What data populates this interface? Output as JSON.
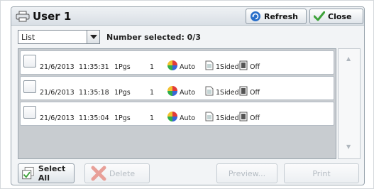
{
  "window": {
    "title": "User 1"
  },
  "header": {
    "refresh_label": "Refresh",
    "close_label": "Close"
  },
  "toolbar": {
    "view_value": "List",
    "selected_text": "Number selected: 0/3"
  },
  "jobs": [
    {
      "date": "21/6/2013",
      "time": "11:35:31",
      "pages": "1Pgs",
      "copies": "1",
      "color": "Auto",
      "sides": "1Sided",
      "staple": "Off"
    },
    {
      "date": "21/6/2013",
      "time": "11:35:18",
      "pages": "1Pgs",
      "copies": "1",
      "color": "Auto",
      "sides": "1Sided",
      "staple": "Off"
    },
    {
      "date": "21/6/2013",
      "time": "11:35:04",
      "pages": "1Pgs",
      "copies": "1",
      "color": "Auto",
      "sides": "1Sided",
      "staple": "Off"
    }
  ],
  "scroll": {
    "up": "▲",
    "down": "▼"
  },
  "actions": {
    "select_all_label": "Select All",
    "delete_label": "Delete",
    "preview_label": "Preview...",
    "print_label": "Print"
  },
  "icons": {
    "title": "printer-icon",
    "refresh": "refresh-icon",
    "close": "checkmark-icon",
    "color_mode": "color-wheel-icon",
    "sides": "page-icon",
    "staple": "staple-icon",
    "select_all": "select-all-icon",
    "delete": "delete-x-icon"
  },
  "colors": {
    "accent_blue": "#2a6fc9",
    "check_green": "#3ea23a",
    "delete_red": "#e05a4a"
  }
}
